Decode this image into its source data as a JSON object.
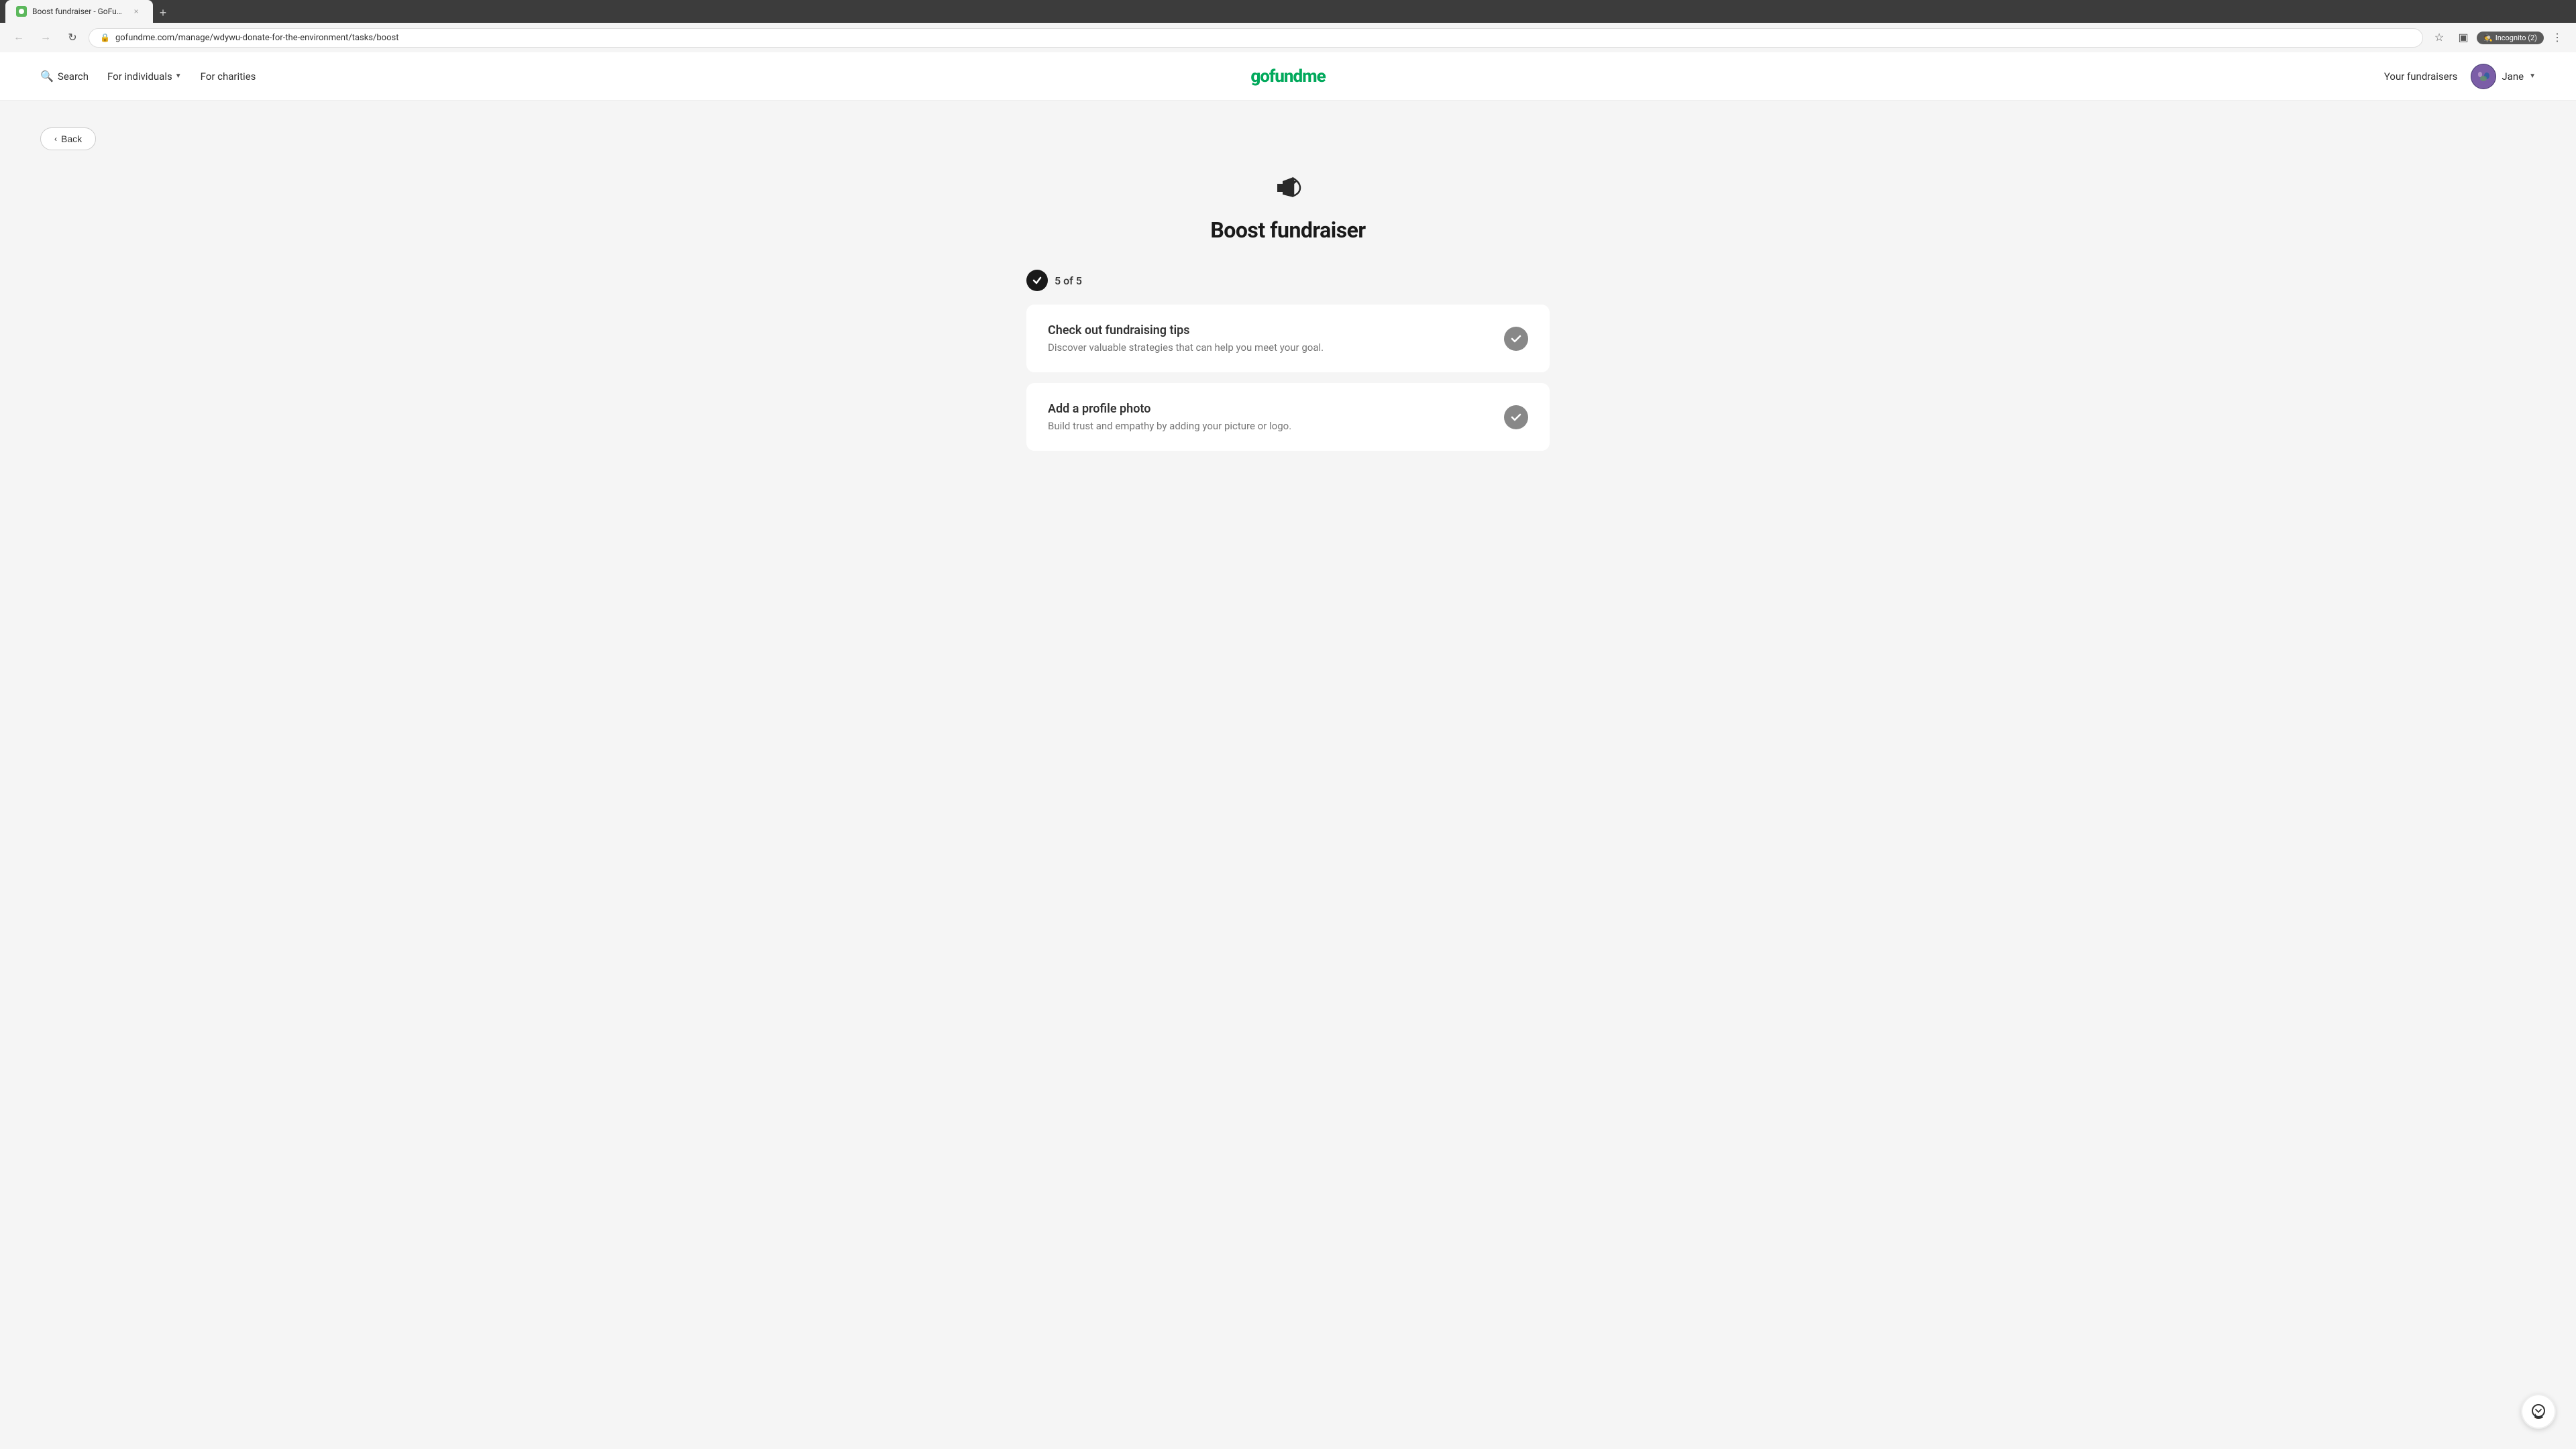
{
  "browser": {
    "tab": {
      "favicon_color": "#5cb85c",
      "title": "Boost fundraiser - GoFundMe",
      "close_label": "×"
    },
    "new_tab_label": "+",
    "nav": {
      "back_disabled": false,
      "forward_disabled": true,
      "refresh_label": "↻",
      "url": "gofundme.com/manage/wdywu-donate-for-the-environment/tasks/boost",
      "bookmark_label": "☆",
      "extensions_label": "⋮"
    },
    "incognito_label": "Incognito (2)"
  },
  "navbar": {
    "search_label": "Search",
    "for_individuals_label": "For individuals",
    "for_charities_label": "For charities",
    "logo_text": "gofundme",
    "your_fundraisers_label": "Your fundraisers",
    "user_name": "Jane",
    "chevron": "▾"
  },
  "page": {
    "back_button_label": "Back",
    "hero_title": "Boost fundraiser",
    "progress_label": "5 of 5",
    "cards": [
      {
        "title": "Check out fundraising tips",
        "description": "Discover valuable strategies that can help you meet your goal.",
        "completed": true
      },
      {
        "title": "Add a profile photo",
        "description": "Build trust and empathy by adding your picture or logo.",
        "completed": true
      }
    ]
  }
}
